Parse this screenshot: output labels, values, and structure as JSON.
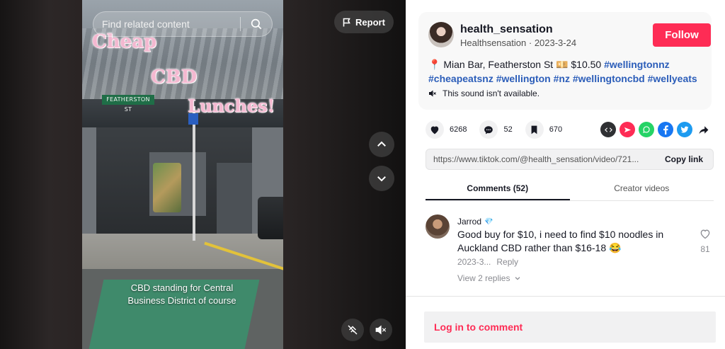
{
  "video": {
    "search_placeholder": "Find related content",
    "report_label": "Report",
    "overlay_line1": "Cheap",
    "overlay_line2": "CBD",
    "overlay_line3": "Lunches!",
    "street_sign": "FEATHERSTON ST",
    "caption": "CBD standing for Central Business District of course"
  },
  "author": {
    "username": "health_sensation",
    "nickname": "Healthsensation",
    "date": "2023-3-24",
    "follow_label": "Follow"
  },
  "description": {
    "pin": "📍",
    "text": " Mian Bar, Featherston St 💴 $10.50 ",
    "hashtags": [
      "#wellingtonnz",
      "#cheapeatsnz",
      "#wellington",
      "#nz",
      "#wellingtoncbd",
      "#wellyeats"
    ],
    "sound": "This sound isn't available."
  },
  "stats": {
    "likes": "6268",
    "comments": "52",
    "saves": "670"
  },
  "share": {
    "link": "https://www.tiktok.com/@health_sensation/video/721...",
    "copy_label": "Copy link",
    "colors": {
      "embed": "#2f3033",
      "send": "#fe2c55",
      "whatsapp": "#25d366",
      "facebook": "#1877f2",
      "twitter": "#1d9bf0"
    }
  },
  "tabs": [
    {
      "label": "Comments (52)",
      "active": true
    },
    {
      "label": "Creator videos",
      "active": false
    }
  ],
  "comment": {
    "user": "Jarrod",
    "badge": "💎",
    "text": "Good buy for $10, i need to find $10 noodles in Auckland CBD rather than $16-18 😂",
    "date": "2023-3...",
    "reply_label": "Reply",
    "view_replies": "View 2 replies",
    "likes": "81"
  },
  "login": {
    "label": "Log in to comment"
  }
}
